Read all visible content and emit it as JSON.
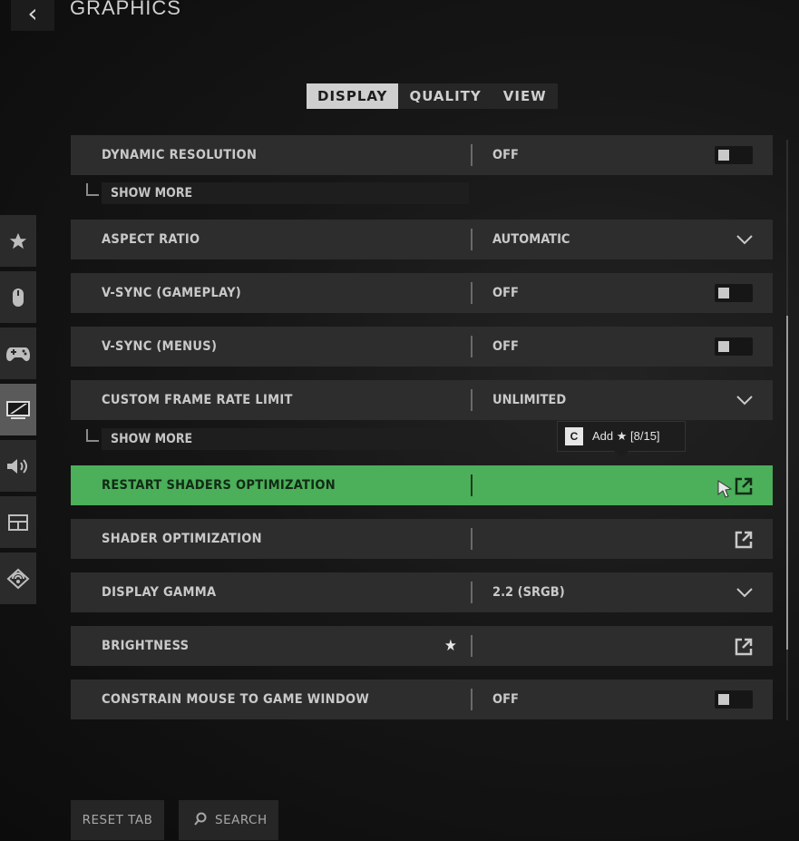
{
  "header": {
    "title": "GRAPHICS",
    "back_icon": "chevron-left-icon"
  },
  "tabs": [
    {
      "label": "DISPLAY",
      "active": true
    },
    {
      "label": "QUALITY",
      "active": false
    },
    {
      "label": "VIEW",
      "active": false
    }
  ],
  "sidenav": [
    "star-icon",
    "mouse-icon",
    "gamepad-icon",
    "display-icon",
    "speaker-icon",
    "interface-icon",
    "network-icon"
  ],
  "settings": {
    "dynamic_resolution": {
      "label": "DYNAMIC RESOLUTION",
      "value": "OFF"
    },
    "show_more_1": "SHOW MORE",
    "aspect_ratio": {
      "label": "ASPECT RATIO",
      "value": "AUTOMATIC"
    },
    "vsync_gameplay": {
      "label": "V-SYNC (GAMEPLAY)",
      "value": "OFF"
    },
    "vsync_menus": {
      "label": "V-SYNC (MENUS)",
      "value": "OFF"
    },
    "frame_rate_limit": {
      "label": "CUSTOM FRAME RATE LIMIT",
      "value": "UNLIMITED"
    },
    "show_more_2": "SHOW MORE",
    "restart_shaders": {
      "label": "RESTART SHADERS OPTIMIZATION"
    },
    "shader_optimization": {
      "label": "SHADER OPTIMIZATION"
    },
    "display_gamma": {
      "label": "DISPLAY GAMMA",
      "value": "2.2 (SRGB)"
    },
    "brightness": {
      "label": "BRIGHTNESS",
      "star": "★"
    },
    "constrain_mouse": {
      "label": "CONSTRAIN MOUSE TO GAME WINDOW",
      "value": "OFF"
    }
  },
  "tooltip": {
    "key": "C",
    "text": "Add ★ [8/15]"
  },
  "footer": {
    "reset": "RESET TAB",
    "search": "SEARCH"
  },
  "colors": {
    "highlight": "#4caf5a",
    "row": "#2d2d2d"
  }
}
